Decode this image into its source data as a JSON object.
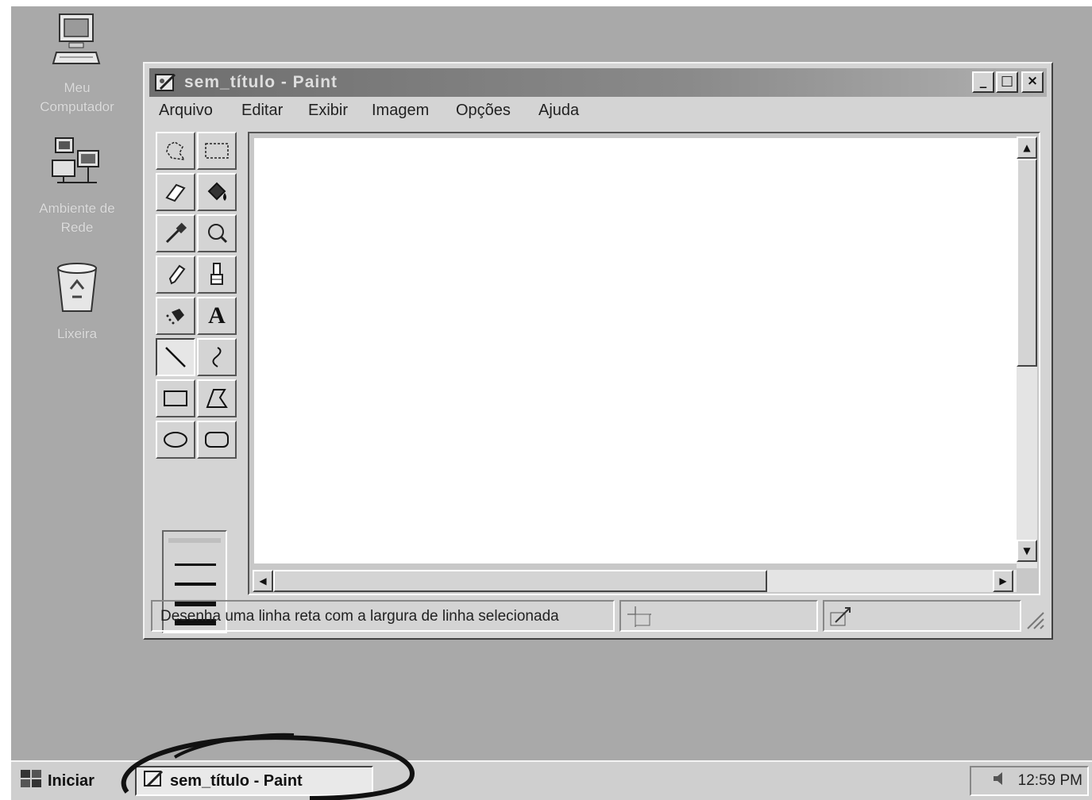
{
  "desktop": {
    "icons": [
      {
        "label_line1": "Meu",
        "label_line2": "Computador",
        "icon": "my-computer-icon"
      },
      {
        "label_line1": "Ambiente de",
        "label_line2": "Rede",
        "icon": "network-icon"
      },
      {
        "label_line1": "Lixeira",
        "label_line2": "",
        "icon": "recycle-bin-icon"
      }
    ]
  },
  "window": {
    "title": "sem_título - Paint",
    "controls": {
      "minimize": "_",
      "maximize": "□",
      "close": "×"
    },
    "menu": [
      "Arquivo",
      "Editar",
      "Exibir",
      "Imagem",
      "Opções",
      "Ajuda"
    ]
  },
  "toolbox": {
    "tools": [
      "free-form-select-icon",
      "rectangle-select-icon",
      "eraser-icon",
      "fill-bucket-icon",
      "color-picker-icon",
      "magnifier-icon",
      "pencil-icon",
      "brush-icon",
      "airbrush-icon",
      "text-icon",
      "line-icon",
      "curve-icon",
      "rectangle-icon",
      "polygon-icon",
      "ellipse-icon",
      "rounded-rectangle-icon"
    ],
    "active_tool": "line-icon",
    "text_tool_glyph": "A",
    "line_widths": 5
  },
  "status": {
    "text": "Desenha uma linha reta com a largura de linha selecionada"
  },
  "taskbar": {
    "start_label": "Iniciar",
    "task_label": "sem_título - Paint",
    "clock": "12:59 PM"
  },
  "colors": {
    "desktop": "#a9a9a9",
    "window_face": "#d4d4d4",
    "title_active": "#7a7a7a",
    "canvas": "#ffffff"
  }
}
